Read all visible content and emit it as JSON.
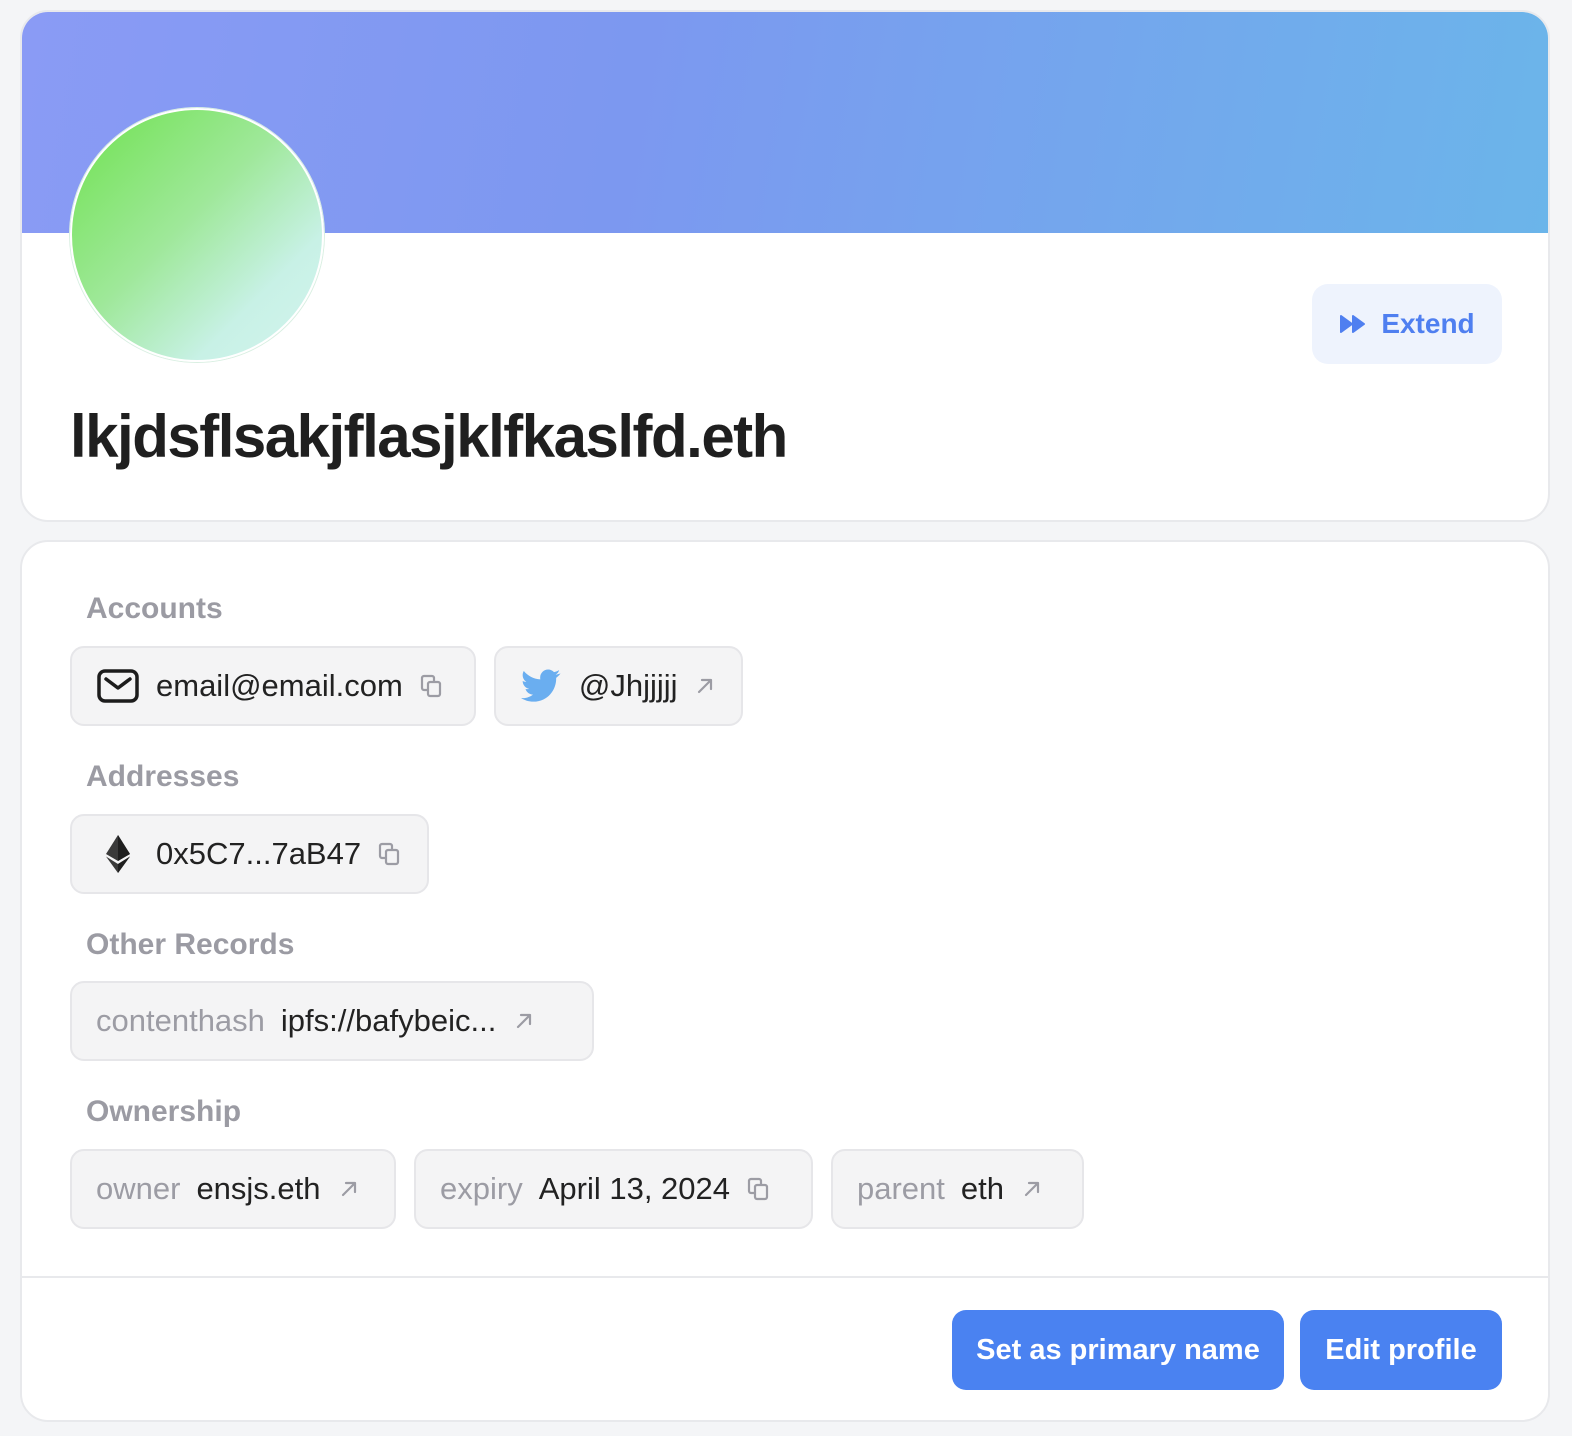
{
  "header": {
    "name": "lkjdsflsakjflasjklfkaslfd.eth",
    "extend_label": "Extend",
    "colors": {
      "banner_start": "#8a9bf5",
      "banner_end": "#6bb5ea",
      "accent": "#4a82f1"
    }
  },
  "sections": {
    "accounts_label": "Accounts",
    "addresses_label": "Addresses",
    "other_records_label": "Other Records",
    "ownership_label": "Ownership"
  },
  "accounts": {
    "email": {
      "icon": "mail-icon",
      "value": "email@email.com",
      "action_icon": "copy-icon"
    },
    "twitter": {
      "icon": "twitter-icon",
      "value": "@Jhjjjjj",
      "action_icon": "external-link-icon"
    }
  },
  "addresses": {
    "eth": {
      "icon": "ethereum-icon",
      "value": "0x5C7...7aB47",
      "action_icon": "copy-icon"
    }
  },
  "other_records": {
    "contenthash": {
      "key": "contenthash",
      "value": "ipfs://bafybeic...",
      "action_icon": "external-link-icon"
    }
  },
  "ownership": {
    "owner": {
      "key": "owner",
      "value": "ensjs.eth",
      "action_icon": "external-link-icon"
    },
    "expiry": {
      "key": "expiry",
      "value": "April 13, 2024",
      "action_icon": "copy-icon"
    },
    "parent": {
      "key": "parent",
      "value": "eth",
      "action_icon": "external-link-icon"
    }
  },
  "actions": {
    "set_primary_label": "Set as primary name",
    "edit_profile_label": "Edit profile"
  }
}
